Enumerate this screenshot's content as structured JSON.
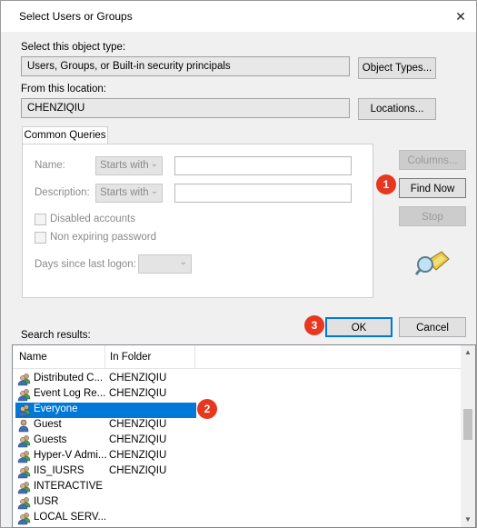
{
  "window": {
    "title": "Select Users or Groups",
    "close_glyph": "✕"
  },
  "object_type": {
    "label": "Select this object type:",
    "value": "Users, Groups, or Built-in security principals",
    "button": "Object Types..."
  },
  "location": {
    "label": "From this location:",
    "value": "CHENZIQIU",
    "button": "Locations..."
  },
  "common_queries": {
    "tab": "Common Queries",
    "name_label": "Name:",
    "name_mode": "Starts with",
    "description_label": "Description:",
    "description_mode": "Starts with",
    "disabled_accounts": "Disabled accounts",
    "non_expiring_password": "Non expiring password",
    "days_since_logon": "Days since last logon:"
  },
  "buttons": {
    "columns": "Columns...",
    "find_now": "Find Now",
    "stop": "Stop",
    "ok": "OK",
    "cancel": "Cancel"
  },
  "badges": {
    "one": "1",
    "two": "2",
    "three": "3"
  },
  "results": {
    "label": "Search results:",
    "columns": [
      "Name",
      "In Folder"
    ],
    "rows": [
      {
        "name": "Distributed C...",
        "folder": "CHENZIQIU",
        "icon": "group-icon"
      },
      {
        "name": "Event Log Re...",
        "folder": "CHENZIQIU",
        "icon": "group-icon"
      },
      {
        "name": "Everyone",
        "folder": "",
        "icon": "group-icon",
        "selected": true
      },
      {
        "name": "Guest",
        "folder": "CHENZIQIU",
        "icon": "user-icon"
      },
      {
        "name": "Guests",
        "folder": "CHENZIQIU",
        "icon": "group-icon"
      },
      {
        "name": "Hyper-V Admi...",
        "folder": "CHENZIQIU",
        "icon": "group-icon"
      },
      {
        "name": "IIS_IUSRS",
        "folder": "CHENZIQIU",
        "icon": "group-icon"
      },
      {
        "name": "INTERACTIVE",
        "folder": "",
        "icon": "group-icon"
      },
      {
        "name": "IUSR",
        "folder": "",
        "icon": "group-icon"
      },
      {
        "name": "LOCAL SERV...",
        "folder": "",
        "icon": "group-icon"
      }
    ]
  }
}
